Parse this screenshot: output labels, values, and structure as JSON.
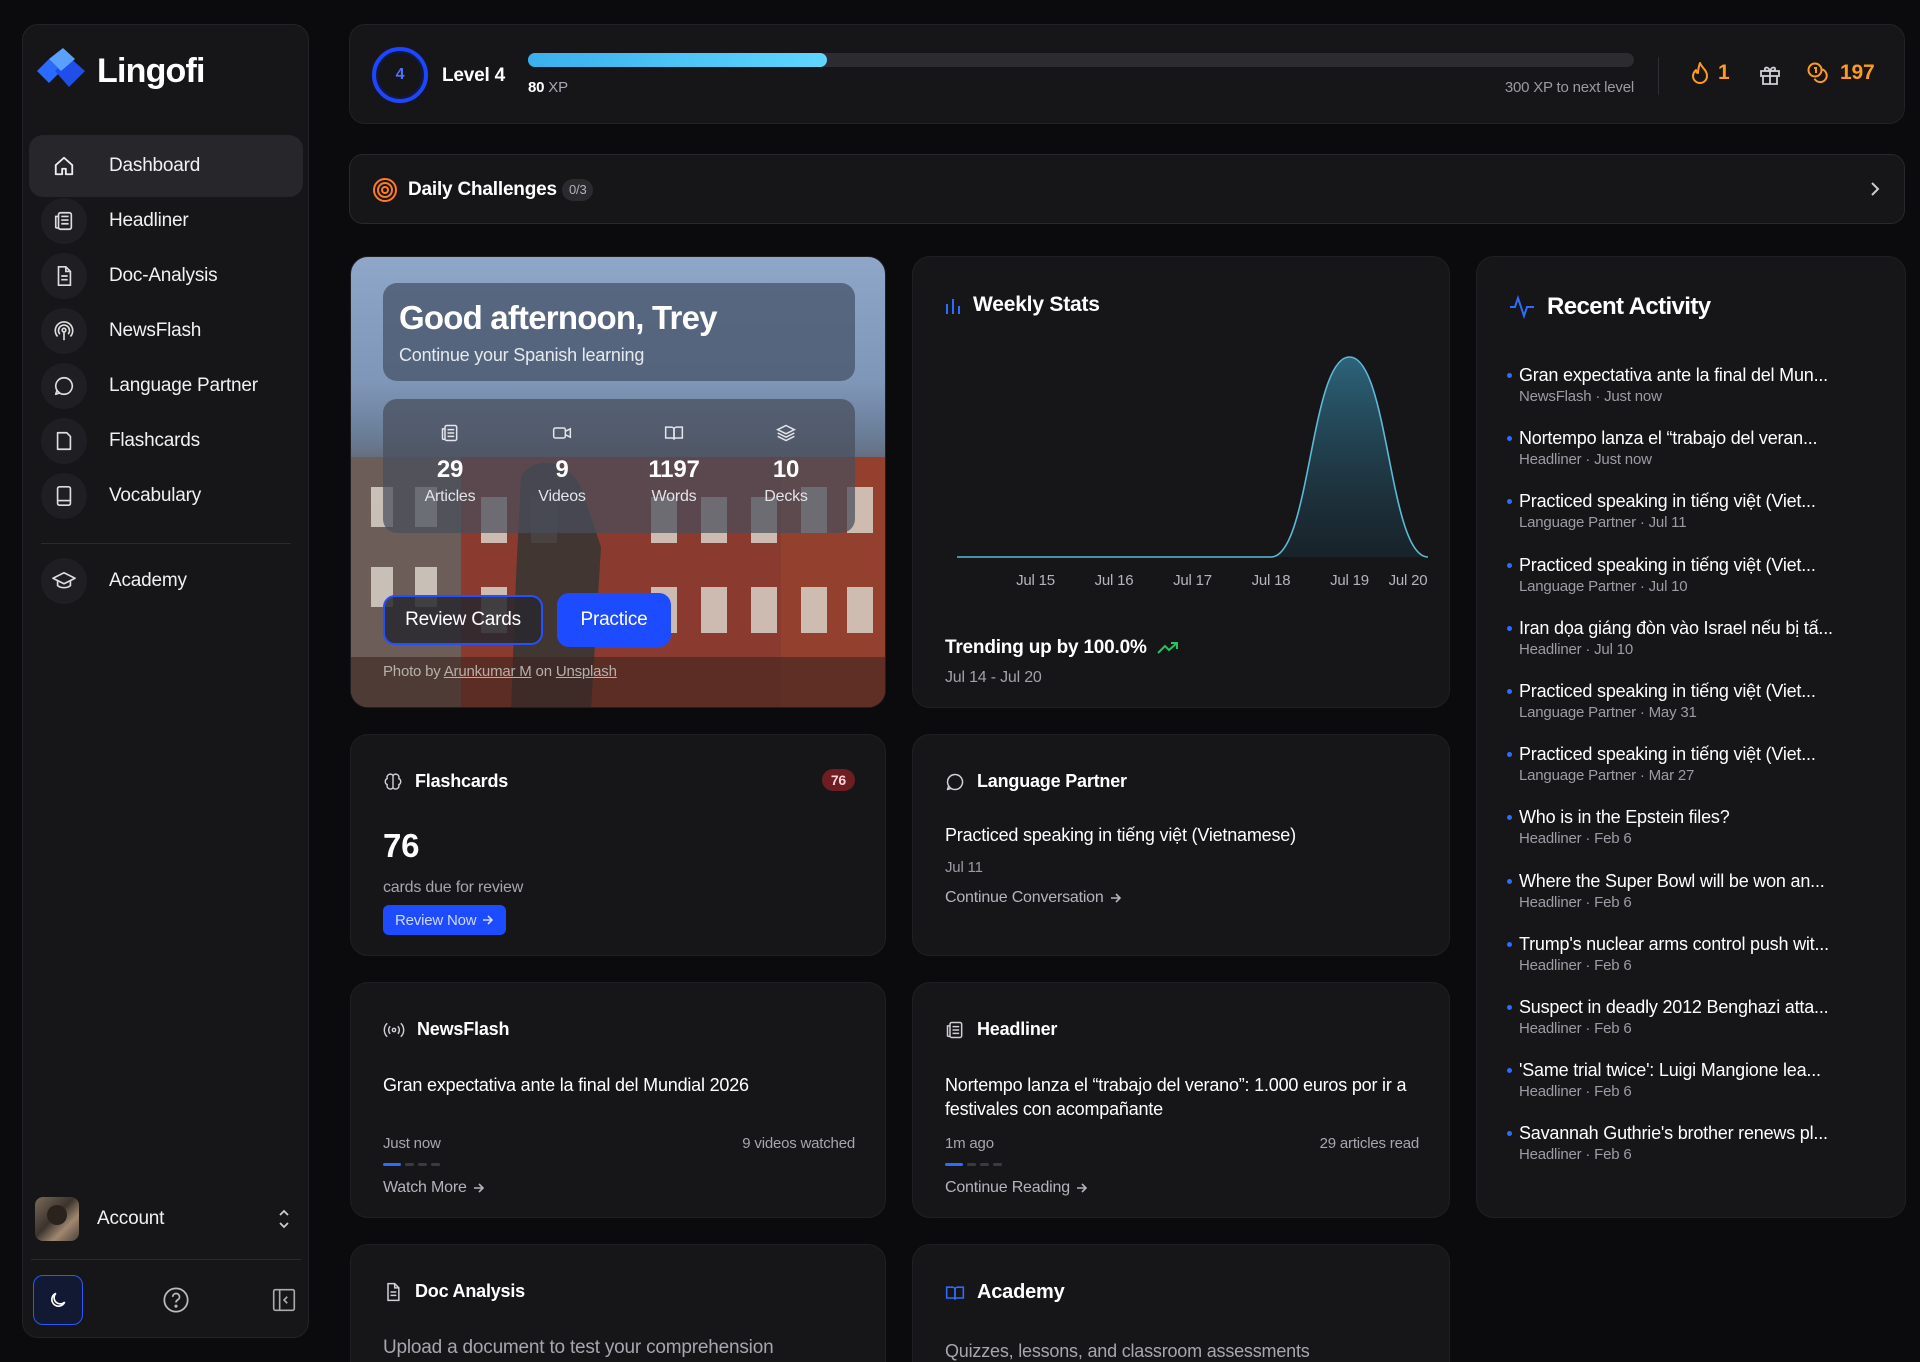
{
  "app": {
    "name": "Lingofi"
  },
  "sidebar": {
    "items": [
      {
        "label": "Dashboard",
        "icon": "home-icon"
      },
      {
        "label": "Headliner",
        "icon": "newspaper-icon"
      },
      {
        "label": "Doc-Analysis",
        "icon": "document-icon"
      },
      {
        "label": "NewsFlash",
        "icon": "broadcast-icon"
      },
      {
        "label": "Language Partner",
        "icon": "chat-icon"
      },
      {
        "label": "Flashcards",
        "icon": "cards-icon"
      },
      {
        "label": "Vocabulary",
        "icon": "tablet-icon"
      },
      {
        "label": "Academy",
        "icon": "graduation-cap-icon"
      }
    ],
    "account_label": "Account"
  },
  "xp": {
    "level_number": "4",
    "level_label": "Level 4",
    "xp_value": "80",
    "xp_unit": "XP",
    "next_level_text": "300 XP to next level",
    "progress_fraction": 0.27,
    "streak": "1",
    "coins": "197"
  },
  "daily": {
    "title": "Daily Challenges",
    "badge": "0/3"
  },
  "hero": {
    "greeting": "Good afternoon, Trey",
    "subtitle": "Continue your Spanish learning",
    "stats": [
      {
        "value": "29",
        "label": "Articles",
        "icon": "newspaper-icon"
      },
      {
        "value": "9",
        "label": "Videos",
        "icon": "video-icon"
      },
      {
        "value": "1197",
        "label": "Words",
        "icon": "book-open-icon"
      },
      {
        "value": "10",
        "label": "Decks",
        "icon": "layers-icon"
      }
    ],
    "review_button": "Review Cards",
    "practice_button": "Practice",
    "credit_prefix": "Photo by ",
    "credit_author": "Arunkumar M",
    "credit_mid": " on ",
    "credit_site": "Unsplash"
  },
  "weekly": {
    "title": "Weekly Stats",
    "trend_text": "Trending up by 100.0%",
    "range": "Jul 14 - Jul 20"
  },
  "chart_data": {
    "type": "area",
    "title": "Weekly Stats",
    "xlabel": "",
    "ylabel": "",
    "categories": [
      "Jul 14",
      "Jul 15",
      "Jul 16",
      "Jul 17",
      "Jul 18",
      "Jul 19",
      "Jul 20"
    ],
    "tick_labels": [
      "Jul 15",
      "Jul 16",
      "Jul 17",
      "Jul 18",
      "Jul 19",
      "Jul 20"
    ],
    "values": [
      0,
      0,
      0,
      0,
      0,
      1,
      0
    ],
    "grid": false,
    "legend": "none",
    "color": "#5fb8d6"
  },
  "recent": {
    "title": "Recent Activity",
    "items": [
      {
        "title": "Gran expectativa ante la final del Mun...",
        "meta": "NewsFlash · Just now"
      },
      {
        "title": "Nortempo lanza el “trabajo del veran...",
        "meta": "Headliner · Just now"
      },
      {
        "title": "Practiced speaking in tiếng việt (Viet...",
        "meta": "Language Partner · Jul 11"
      },
      {
        "title": "Practiced speaking in tiếng việt (Viet...",
        "meta": "Language Partner · Jul 10"
      },
      {
        "title": "Iran dọa giáng đòn vào Israel nếu bị tấ...",
        "meta": "Headliner · Jul 10"
      },
      {
        "title": "Practiced speaking in tiếng việt (Viet...",
        "meta": "Language Partner · May 31"
      },
      {
        "title": "Practiced speaking in tiếng việt (Viet...",
        "meta": "Language Partner · Mar 27"
      },
      {
        "title": "Who is in the Epstein files?",
        "meta": "Headliner · Feb 6"
      },
      {
        "title": "Where the Super Bowl will be won an...",
        "meta": "Headliner · Feb 6"
      },
      {
        "title": "Trump's nuclear arms control push wit...",
        "meta": "Headliner · Feb 6"
      },
      {
        "title": "Suspect in deadly 2012 Benghazi atta...",
        "meta": "Headliner · Feb 6"
      },
      {
        "title": "'Same trial twice': Luigi Mangione lea...",
        "meta": "Headliner · Feb 6"
      },
      {
        "title": "Savannah Guthrie's brother renews pl...",
        "meta": "Headliner · Feb 6"
      }
    ]
  },
  "flashcards": {
    "title": "Flashcards",
    "badge": "76",
    "count": "76",
    "subtitle": "cards due for review",
    "button": "Review Now"
  },
  "language_partner": {
    "title": "Language Partner",
    "session": "Practiced speaking in tiếng việt (Vietnamese)",
    "date": "Jul 11",
    "link": "Continue Conversation"
  },
  "newsflash": {
    "title": "NewsFlash",
    "headline": "Gran expectativa ante la final del Mundial 2026",
    "time": "Just now",
    "count": "9 videos watched",
    "link": "Watch More"
  },
  "headliner": {
    "title": "Headliner",
    "headline": "Nortempo lanza el “trabajo del verano”: 1.000 euros por ir a festivales con acompañante",
    "time": "1m ago",
    "count": "29 articles read",
    "link": "Continue Reading"
  },
  "doc_analysis": {
    "title": "Doc Analysis",
    "subtitle": "Upload a document to test your comprehension"
  },
  "academy": {
    "title": "Academy",
    "subtitle": "Quizzes, lessons, and classroom assessments"
  }
}
